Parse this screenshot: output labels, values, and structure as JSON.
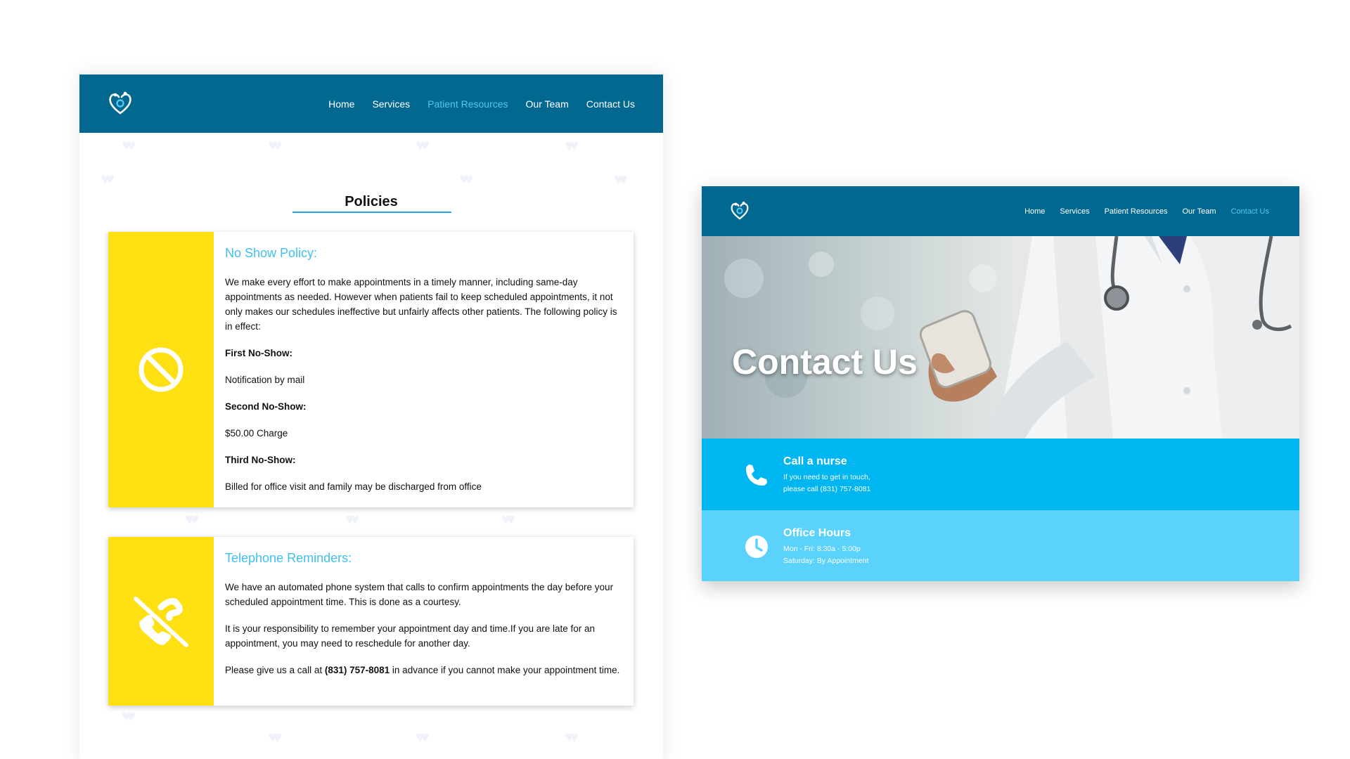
{
  "policies_page": {
    "nav": {
      "logo_icon": "heart-family-logo-icon",
      "links": [
        "Home",
        "Services",
        "Patient Resources",
        "Our Team",
        "Contact Us"
      ],
      "active_link": "Patient Resources"
    },
    "section_title": "Policies",
    "no_show_card": {
      "icon": "prohibited-icon",
      "heading": "No Show Policy:",
      "intro": "We make every effort to make appointments in a timely manner, including same-day appointments as needed. However when patients fail to keep scheduled appointments, it not only makes our schedules ineffective but unfairly affects other patients. The following policy is in effect:",
      "rules": [
        {
          "label": "First No-Show:",
          "value": "Notification by mail"
        },
        {
          "label": "Second No-Show:",
          "value": "$50.00 Charge"
        },
        {
          "label": "Third No-Show:",
          "value": "Billed for office visit and family may be discharged from office"
        }
      ]
    },
    "telephone_card": {
      "icon": "phone-slash-icon",
      "heading": "Telephone Reminders:",
      "paragraph_1": "We have an automated phone system that calls to confirm appointments the day before your scheduled appointment time. This is done as a courtesy.",
      "paragraph_2": "It is your responsibility to remember your appointment day and time.If you are late for an appointment, you may need to reschedule for another day.",
      "paragraph_3_before": "Please give us a call at ",
      "paragraph_3_phone": "(831) 757-8081",
      "paragraph_3_after": " in advance if you cannot make your appointment time."
    }
  },
  "contact_page": {
    "nav": {
      "logo_icon": "heart-family-logo-icon",
      "links": [
        "Home",
        "Services",
        "Patient Resources",
        "Our Team",
        "Contact Us"
      ],
      "active_link": "Contact Us"
    },
    "hero_title": "Contact Us",
    "call_nurse": {
      "icon": "phone-icon",
      "title": "Call a nurse",
      "line_1": "If you need to get in touch,",
      "line_2": "please call (831) 757-8081"
    },
    "office_hours": {
      "icon": "clock-icon",
      "title": "Office Hours",
      "line_1": "Mon - Fri: 8:30a - 5:00p",
      "line_2": "Saturday: By Appointment"
    }
  },
  "colors": {
    "nav_bg": "#03688f",
    "nav_active": "#52c8f4",
    "card_accent": "#ffe012",
    "heading_blue": "#3fc0f0",
    "call_row": "#00b6f1",
    "hours_row": "#5ad2fb"
  }
}
